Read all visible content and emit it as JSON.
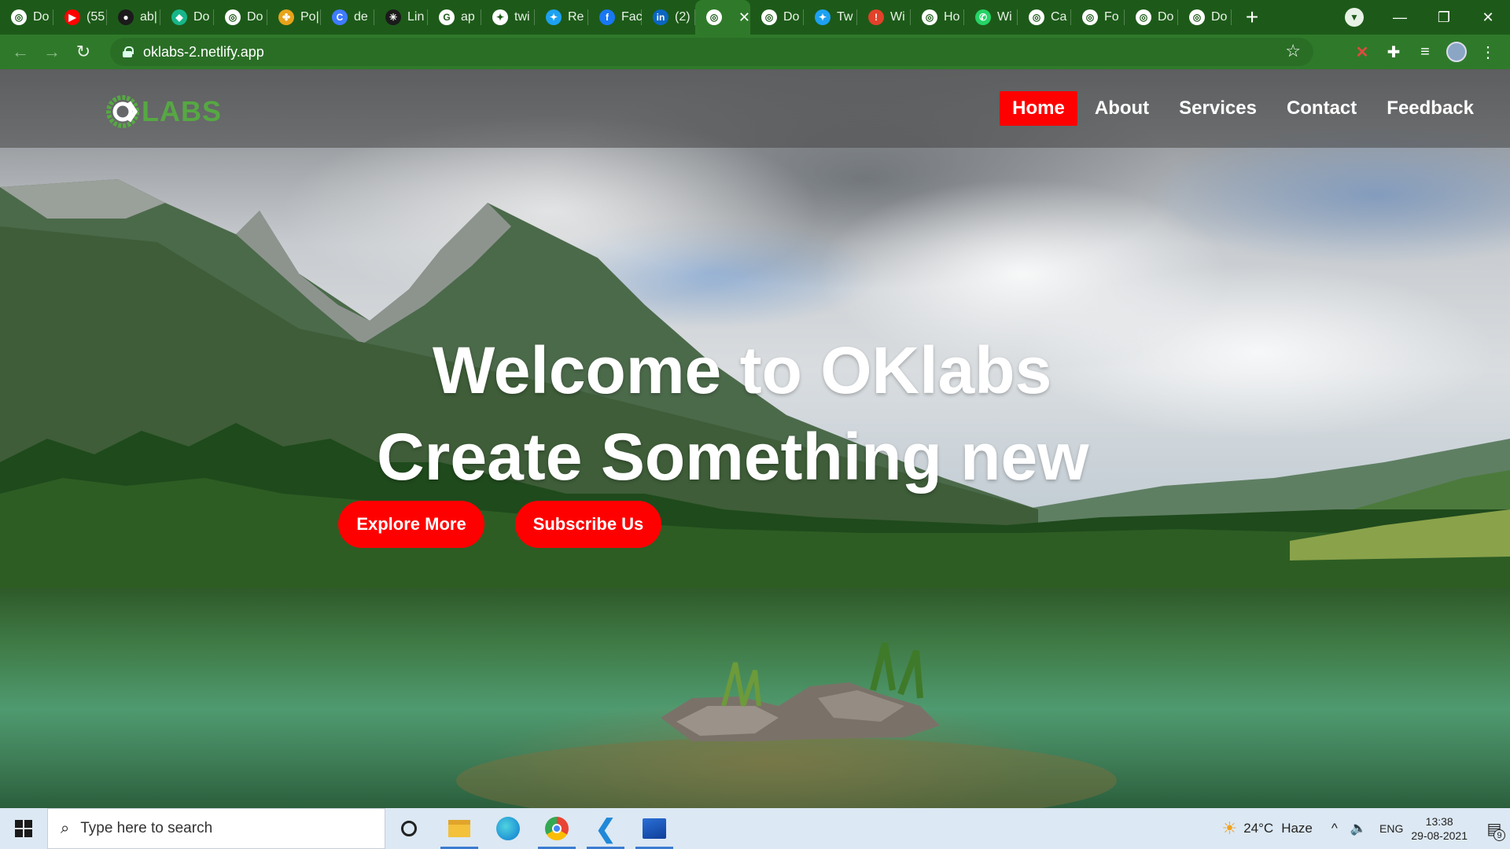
{
  "browser": {
    "tabs": [
      {
        "title": "Do",
        "icon": "globe-icon",
        "color": "#ffffff"
      },
      {
        "title": "(55",
        "icon": "youtube-icon",
        "color": "#ff0000"
      },
      {
        "title": "ab|",
        "icon": "github-icon",
        "color": "#1b1b1b"
      },
      {
        "title": "Do",
        "icon": "diamond-icon",
        "color": "#17b68a"
      },
      {
        "title": "Do",
        "icon": "globe-icon",
        "color": "#ffffff"
      },
      {
        "title": "Po|",
        "icon": "pinwheel-icon",
        "color": "#e8a31b"
      },
      {
        "title": "de",
        "icon": "c-icon",
        "color": "#3e7bff"
      },
      {
        "title": "Lin",
        "icon": "linktree-icon",
        "color": "#1b1b1b"
      },
      {
        "title": "ap",
        "icon": "google-icon",
        "color": "#ffffff"
      },
      {
        "title": "twi",
        "icon": "twitter-icon",
        "color": "#ffffff"
      },
      {
        "title": "Re",
        "icon": "twitter-icon",
        "color": "#1da1f2"
      },
      {
        "title": "Fac",
        "icon": "facebook-icon",
        "color": "#1877f2"
      },
      {
        "title": "(2)",
        "icon": "linkedin-icon",
        "color": "#0a66c2"
      },
      {
        "title": "",
        "icon": "globe-icon",
        "color": "#ffffff",
        "active": true
      },
      {
        "title": "Do",
        "icon": "globe-icon",
        "color": "#ffffff"
      },
      {
        "title": "Tw",
        "icon": "twitter-icon",
        "color": "#1da1f2"
      },
      {
        "title": "Wi",
        "icon": "warning-icon",
        "color": "#e2412a"
      },
      {
        "title": "Ho",
        "icon": "globe-icon",
        "color": "#ffffff"
      },
      {
        "title": "Wi",
        "icon": "whatsapp-icon",
        "color": "#25d366"
      },
      {
        "title": "Ca",
        "icon": "globe-icon",
        "color": "#ffffff"
      },
      {
        "title": "Fo",
        "icon": "globe-icon",
        "color": "#ffffff"
      },
      {
        "title": "Do",
        "icon": "globe-icon",
        "color": "#ffffff"
      },
      {
        "title": "Do",
        "icon": "globe-icon",
        "color": "#ffffff"
      }
    ],
    "new_tab": "+",
    "url": "oklabs-2.netlify.app",
    "colors": {
      "tabstrip": "#1d5a19",
      "toolbar": "#2f7a2a"
    }
  },
  "site": {
    "logo_text": "LABS",
    "logo_mark": "OK",
    "nav": [
      "Home",
      "About",
      "Services",
      "Contact",
      "Feedback"
    ],
    "active_nav": "Home",
    "hero_line_1": "Welcome to OKlabs",
    "hero_line_2": "Create Something new",
    "buttons": {
      "explore": "Explore More",
      "subscribe": "Subscribe Us"
    },
    "colors": {
      "accent": "#ff0000",
      "logo_green": "#56a843"
    }
  },
  "taskbar": {
    "search_placeholder": "Type here to search",
    "weather": "24°C",
    "weather_text": "Haze",
    "language": "ENG",
    "time": "13:38",
    "date": "29-08-2021",
    "notifications": "9"
  }
}
